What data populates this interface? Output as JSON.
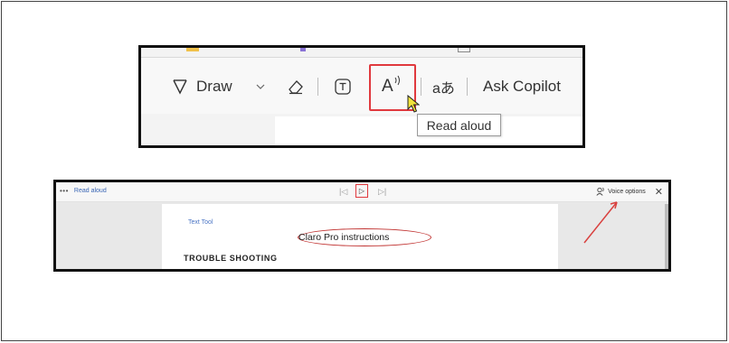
{
  "toolbar": {
    "draw_label": "Draw",
    "read_aloud_glyph": "A",
    "translate_glyph": "aあ",
    "ask_copilot_label": "Ask Copilot",
    "tooltip_text": "Read aloud"
  },
  "read_aloud_bar": {
    "dots": "•••",
    "title": "Read aloud",
    "prev_glyph": "|◁",
    "play_glyph": "▷",
    "next_glyph": "▷|",
    "voice_options_label": "Voice options",
    "close_glyph": "✕"
  },
  "document": {
    "tool_name": "Text Tool",
    "title": "Claro Pro instructions",
    "heading": "TROUBLE SHOOTING"
  },
  "colors": {
    "highlight_red": "#e0393e",
    "link_blue": "#3b67b5",
    "cursor_yellow": "#f2e33b"
  },
  "icons": [
    "draw-icon",
    "chevron-down-icon",
    "eraser-icon",
    "text-box-icon",
    "read-aloud-icon",
    "translate-icon",
    "cursor-icon",
    "voice-options-icon",
    "close-icon",
    "arrow-annotation-icon"
  ]
}
